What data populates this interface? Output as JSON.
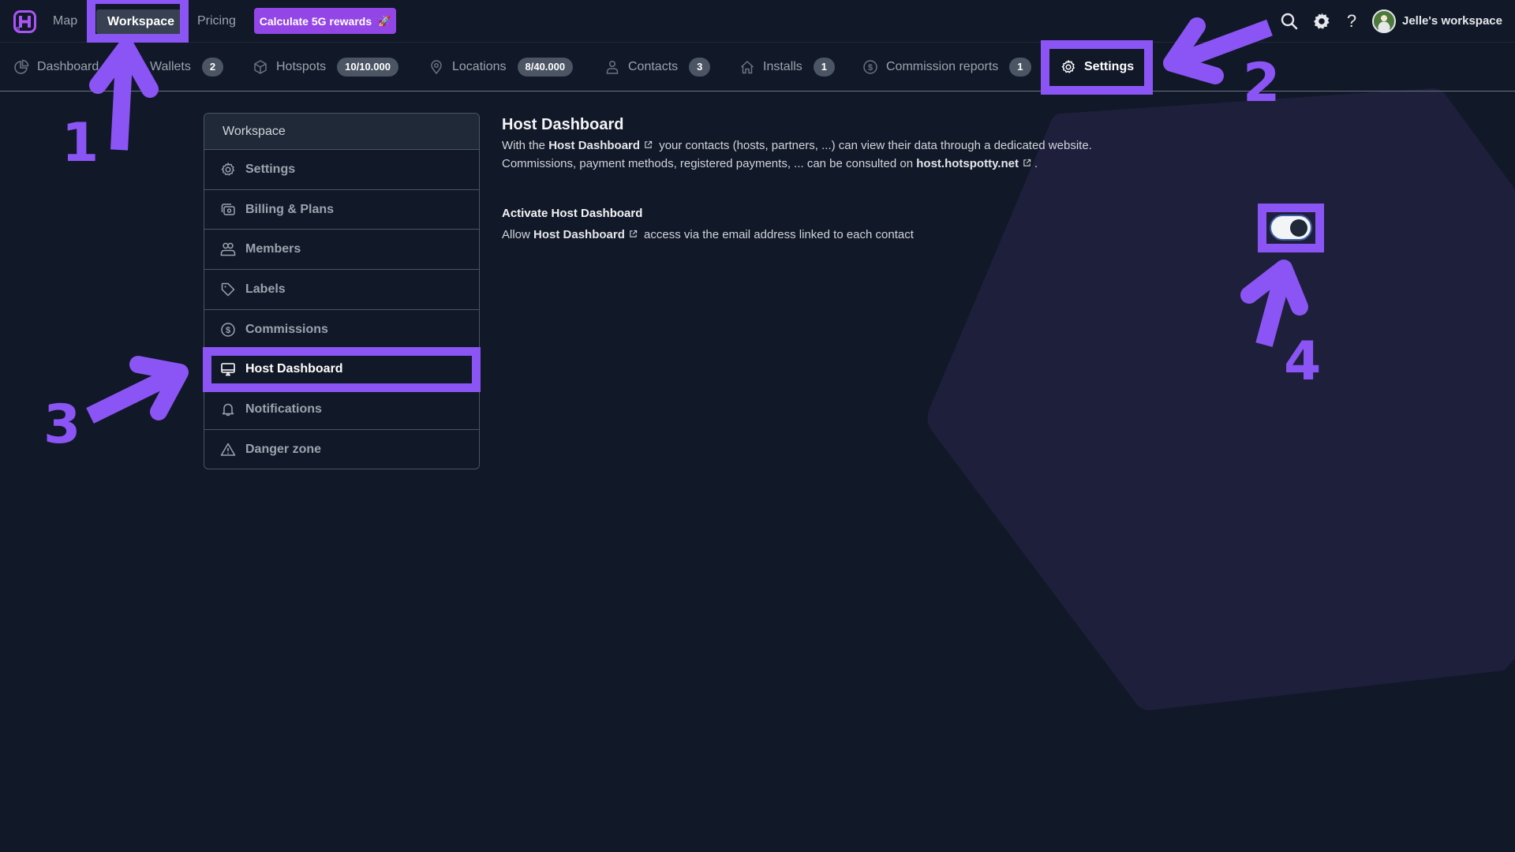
{
  "colors": {
    "background": "#111827",
    "hexagon": "#1e1f3b",
    "accent": "#9346e6",
    "annotation": "#8b55f5",
    "badge": "#4b5563"
  },
  "topbar": {
    "logo_icon": "hotspotty-logo-icon",
    "links": [
      {
        "label": "Map"
      },
      {
        "label": "Workspace",
        "active": true
      },
      {
        "label": "Pricing"
      }
    ],
    "cta": {
      "label": "Calculate 5G rewards",
      "icon": "rocket-icon",
      "emoji": "🚀"
    },
    "icons": [
      "search-icon",
      "gear-icon",
      "help-icon"
    ],
    "help_glyph": "?",
    "workspace_name": "Jelle's workspace"
  },
  "subnav": {
    "items": [
      {
        "label": "Dashboard",
        "icon": "pie-chart-icon"
      },
      {
        "label": "Wallets",
        "badge": "2"
      },
      {
        "label": "Hotspots",
        "icon": "cube-icon",
        "badge": "10/10.000"
      },
      {
        "label": "Locations",
        "icon": "map-pin-icon",
        "badge": "8/40.000"
      },
      {
        "label": "Contacts",
        "icon": "user-icon",
        "badge": "3"
      },
      {
        "label": "Installs",
        "icon": "home-icon",
        "badge": "1"
      },
      {
        "label": "Commission reports",
        "icon": "dollar-circle-icon",
        "badge": "1"
      },
      {
        "label": "Settings",
        "icon": "gear-icon",
        "active": true
      }
    ]
  },
  "sidebar": {
    "header": "Workspace",
    "items": [
      {
        "label": "Settings",
        "icon": "gear-icon"
      },
      {
        "label": "Billing & Plans",
        "icon": "billing-icon"
      },
      {
        "label": "Members",
        "icon": "users-icon"
      },
      {
        "label": "Labels",
        "icon": "tag-icon"
      },
      {
        "label": "Commissions",
        "icon": "dollar-circle-icon"
      },
      {
        "label": "Host Dashboard",
        "icon": "monitor-icon",
        "active": true
      },
      {
        "label": "Notifications",
        "icon": "bell-icon"
      },
      {
        "label": "Danger zone",
        "icon": "warning-icon"
      }
    ]
  },
  "content": {
    "title": "Host Dashboard",
    "desc_line1_pre": "With the ",
    "desc_line1_bold": "Host Dashboard",
    "desc_line1_post": " your contacts (hosts, partners, ...) can view their data through a dedicated website.",
    "desc_line2_pre": "Commissions, payment methods, registered payments, ... can be consulted on ",
    "desc_line2_bold": "host.hotspotty.net",
    "desc_line2_post": ".",
    "setting": {
      "title": "Activate Host Dashboard",
      "desc_pre": "Allow ",
      "desc_bold": "Host Dashboard",
      "desc_post": " access via the email address linked to each contact",
      "toggle_on": true
    }
  },
  "annotations": {
    "steps": [
      "1",
      "2",
      "3",
      "4"
    ]
  }
}
